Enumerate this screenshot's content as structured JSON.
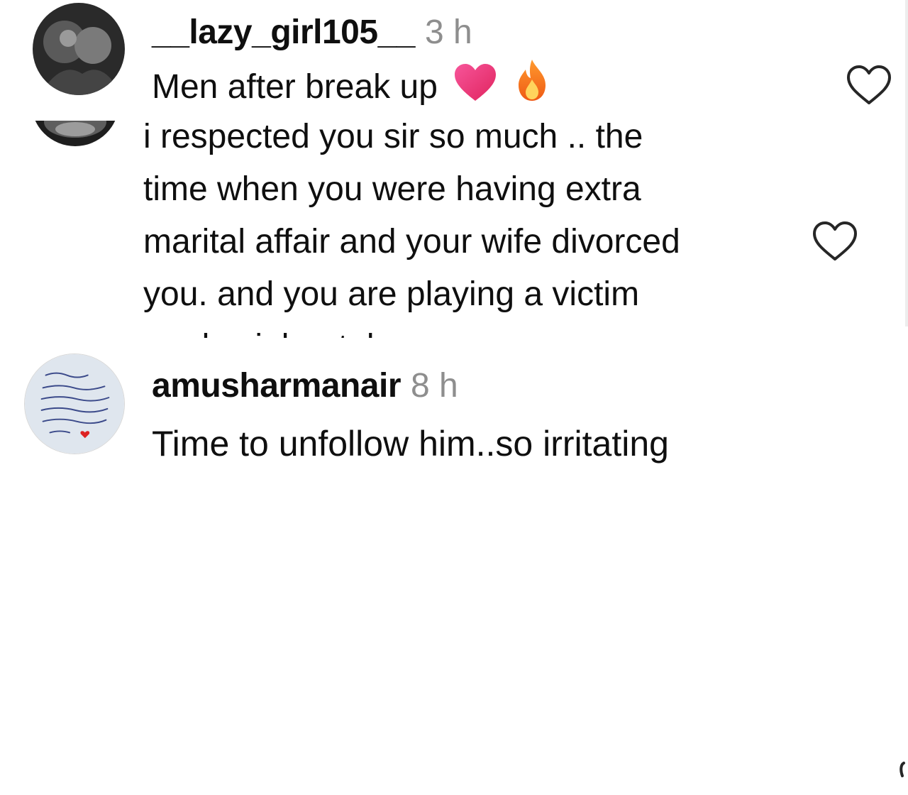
{
  "comments": [
    {
      "username": "__lazy_girl105__",
      "time": "3 h",
      "text": "Men after break up",
      "emojis": [
        "heart-emoji",
        "fire-emoji"
      ]
    },
    {
      "username": "",
      "time": "",
      "lines": [
        "i respected you sir so much .. the",
        "time when you were having extra",
        "marital affair and your wife divorced",
        "you. and you are playing a victim",
        "card axiubuetalu"
      ]
    },
    {
      "username": "amusharmanair",
      "time": "8 h",
      "text": "Time to unfollow him..so irritating"
    }
  ],
  "icons": {
    "like": "heart-outline-icon"
  },
  "colors": {
    "text": "#0f0f0f",
    "muted": "#8e8e8e",
    "heart_emoji": "#ec3a6e",
    "fire_emoji": "#f47a16"
  }
}
